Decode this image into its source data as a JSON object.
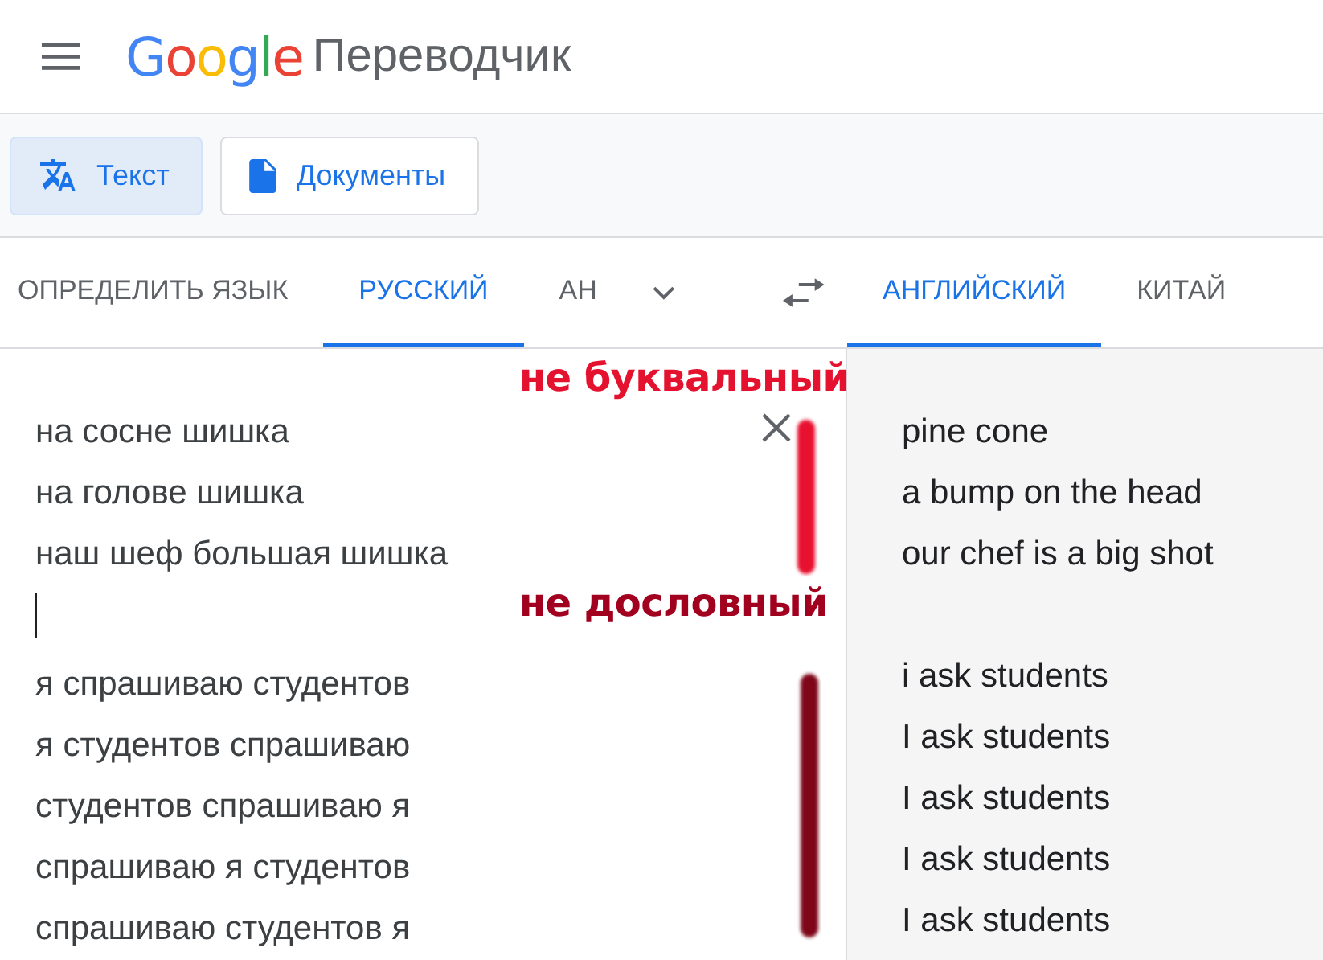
{
  "header": {
    "logo": "Google",
    "title": "Переводчик"
  },
  "modes": [
    {
      "label": "Текст",
      "kind": "text",
      "selected": true
    },
    {
      "label": "Документы",
      "kind": "document",
      "selected": false
    }
  ],
  "source_langs": [
    {
      "label": "ОПРЕДЕЛИТЬ ЯЗЫК",
      "selected": false
    },
    {
      "label": "РУССКИЙ",
      "selected": true
    },
    {
      "label": "АН",
      "selected": false
    }
  ],
  "target_langs": [
    {
      "label": "АНГЛИЙСКИЙ",
      "selected": true
    },
    {
      "label": "КИТАЙ",
      "selected": false
    }
  ],
  "source_lines": [
    {
      "kind": "text",
      "text": "на сосне шишка"
    },
    {
      "kind": "text",
      "text": "на голове шишка"
    },
    {
      "kind": "text",
      "text": "наш шеф большая шишка"
    },
    {
      "kind": "caret"
    },
    {
      "kind": "text",
      "text": "я спрашиваю студентов"
    },
    {
      "kind": "text",
      "text": "я студентов спрашиваю"
    },
    {
      "kind": "text",
      "text": "студентов спрашиваю я"
    },
    {
      "kind": "text",
      "text": "спрашиваю я студентов"
    },
    {
      "kind": "text",
      "text": "спрашиваю студентов я"
    }
  ],
  "target_lines": [
    {
      "kind": "text",
      "text": "pine cone"
    },
    {
      "kind": "text",
      "text": "a bump on the head"
    },
    {
      "kind": "text",
      "text": "our chef is a big shot"
    },
    {
      "kind": "blank"
    },
    {
      "kind": "text",
      "text": "i ask students"
    },
    {
      "kind": "text",
      "text": "I ask students"
    },
    {
      "kind": "text",
      "text": "I ask students"
    },
    {
      "kind": "text",
      "text": "I ask students"
    },
    {
      "kind": "text",
      "text": "I ask students"
    }
  ],
  "annotations": [
    {
      "text": "не буквальный",
      "color": "#e4112f"
    },
    {
      "text": "не дословный",
      "color": "#a1001f"
    }
  ],
  "marks": [
    {
      "color": "#e8112f"
    },
    {
      "color": "#7e0618"
    }
  ]
}
